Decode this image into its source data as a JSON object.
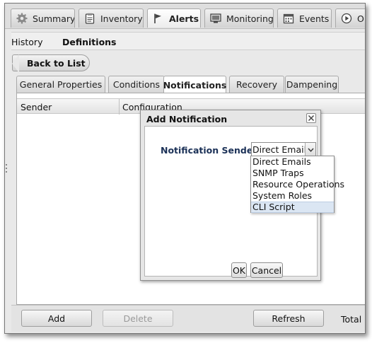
{
  "top_tabs": [
    {
      "label": "Summary",
      "icon": "gear-icon"
    },
    {
      "label": "Inventory",
      "icon": "clipboard-icon"
    },
    {
      "label": "Alerts",
      "icon": "flag-icon"
    },
    {
      "label": "Monitoring",
      "icon": "monitor-icon"
    },
    {
      "label": "Events",
      "icon": "calendar-icon"
    },
    {
      "label": "Op",
      "icon": "play-icon"
    }
  ],
  "active_top_tab": "Alerts",
  "subnav": {
    "history": "History",
    "definitions": "Definitions"
  },
  "back_button": "Back to List",
  "inner_tabs": [
    "General Properties",
    "Conditions",
    "Notifications",
    "Recovery",
    "Dampening"
  ],
  "active_inner_tab": "Notifications",
  "grid": {
    "columns": [
      "Sender",
      "Configuration"
    ]
  },
  "toolbar": {
    "add": "Add",
    "delete": "Delete",
    "refresh": "Refresh",
    "total": "Total R"
  },
  "dialog": {
    "title": "Add Notification",
    "sender_label": "Notification Sender :",
    "selected_sender": "Direct Emails",
    "options": [
      "Direct Emails",
      "SNMP Traps",
      "Resource Operations",
      "System Roles",
      "CLI Script"
    ],
    "highlighted_option": "CLI Script",
    "ok": "OK",
    "cancel": "Cancel"
  },
  "colors": {
    "label_blue": "#1b3157",
    "highlight": "#dbe6f3"
  }
}
